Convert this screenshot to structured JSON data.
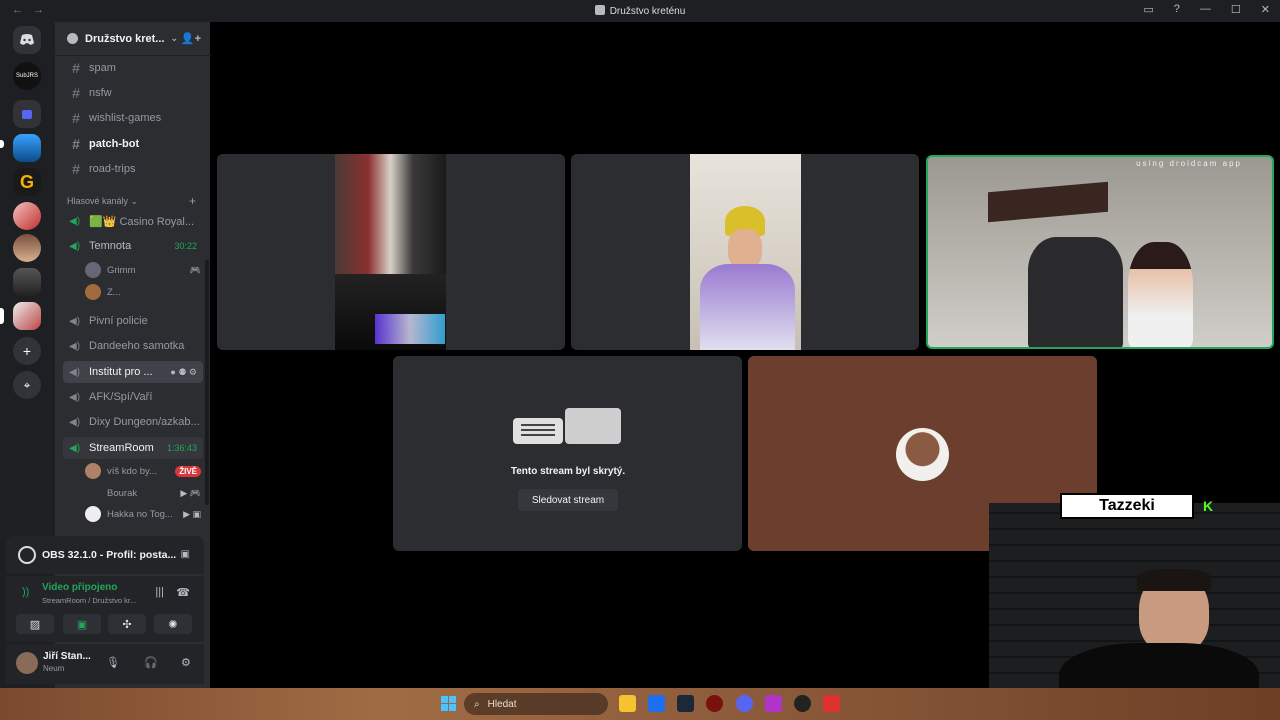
{
  "titlebar": {
    "back": "←",
    "forward": "→",
    "title": "Družstvo kreténu",
    "inbox": "▭",
    "help": "?",
    "minimize": "—",
    "maximize": "☐",
    "close": "✕"
  },
  "servers": [
    {
      "name": "discord-home",
      "label": ""
    },
    {
      "name": "server-subjrs",
      "label": "SubJRS"
    },
    {
      "name": "folder",
      "label": ""
    },
    {
      "name": "server-1",
      "label": ""
    },
    {
      "name": "server-g",
      "label": "G"
    },
    {
      "name": "server-3",
      "label": ""
    },
    {
      "name": "server-4",
      "label": ""
    },
    {
      "name": "server-5",
      "label": ""
    },
    {
      "name": "server-6",
      "label": ""
    }
  ],
  "server_actions": {
    "add": "+",
    "discover": "⌖"
  },
  "guild": {
    "name": "Družstvo kret...",
    "chevron": "⌄",
    "invite": "👤+"
  },
  "text_channels": [
    {
      "label": "spam",
      "bold": false
    },
    {
      "label": "nsfw",
      "bold": false
    },
    {
      "label": "wishlist-games",
      "bold": false
    },
    {
      "label": "patch-bot",
      "bold": true
    },
    {
      "label": "road-trips",
      "bold": false
    }
  ],
  "voice_category": {
    "label": "Hlasové kanály",
    "chevron": "⌄",
    "add": "+"
  },
  "voice_channels": {
    "casino": "🟩👑 Casino Royal...",
    "temnota": "Temnota",
    "temnota_timer": "30:22",
    "temnota_users": [
      "Grimm",
      "Z..."
    ],
    "pivni": "Pivní policie",
    "dandeeho": "Dandeeho samotka",
    "institut": "Institut pro ...",
    "afk": "AFK/Spí/Vaří",
    "dixy": "Dixy Dungeon/azkab...",
    "streamroom": "StreamRoom",
    "streamroom_timer": "1:36:43",
    "streamroom_users": [
      "víš kdo by...",
      "Bourak",
      "Hakka no Tog..."
    ],
    "live": "ŽIVĚ"
  },
  "obs": {
    "label": "OBS 32.1.0 - Profil: posta...",
    "screen_icon": "▣"
  },
  "rtc": {
    "status": "Video připojeno",
    "location": "StreamRoom / Družstvo kr...",
    "noise": "|||",
    "disconnect": "☎"
  },
  "rtc_buttons": [
    "▨",
    "▣",
    "✣",
    "✺"
  ],
  "me": {
    "name": "Jiří Stan...",
    "status": "Neum",
    "mic": "🎙",
    "headset": "🎧",
    "settings": "⚙"
  },
  "streams": {
    "droidcam_caption": "using droidcam app",
    "hidden_message": "Tento stream byl skrytý.",
    "watch_button": "Sledovat stream"
  },
  "overlay": {
    "name": "Tazzeki",
    "kick": "K"
  },
  "taskbar": {
    "search": "Hledat"
  },
  "colors": {
    "accent_green": "#23a55a",
    "live_red": "#da373c",
    "kick_green": "#53fc18",
    "bg_dark": "#000000"
  }
}
